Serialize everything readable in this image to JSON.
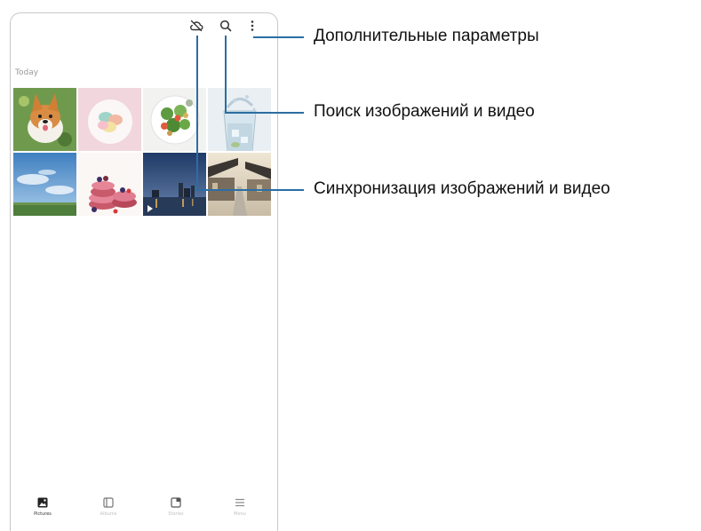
{
  "app": {
    "section_title": "Today",
    "toolbar": {
      "sync_icon": "cloud-off-icon",
      "search_icon": "search-icon",
      "more_icon": "more-vertical-icon"
    },
    "grid": [
      {
        "subject": "corgi dog on grass"
      },
      {
        "subject": "macarons on plate"
      },
      {
        "subject": "salad bowl"
      },
      {
        "subject": "glass of water splash"
      },
      {
        "subject": "blue sky over field"
      },
      {
        "subject": "stack of berries and macarons"
      },
      {
        "subject": "city at dusk",
        "is_video": true
      },
      {
        "subject": "traditional houses street"
      }
    ],
    "bottom_nav": [
      {
        "label": "Pictures",
        "icon": "pictures-icon",
        "active": true
      },
      {
        "label": "Albums",
        "icon": "albums-icon",
        "active": false
      },
      {
        "label": "Stories",
        "icon": "stories-icon",
        "active": false
      },
      {
        "label": "Menu",
        "icon": "menu-icon",
        "active": false
      }
    ]
  },
  "callouts": {
    "more_options": "Дополнительные параметры",
    "search": "Поиск изображений и видео",
    "sync": "Синхронизация изображений и видео"
  },
  "colors": {
    "callout_line": "#2b6ea3",
    "frame_border": "#c8c8c8"
  }
}
